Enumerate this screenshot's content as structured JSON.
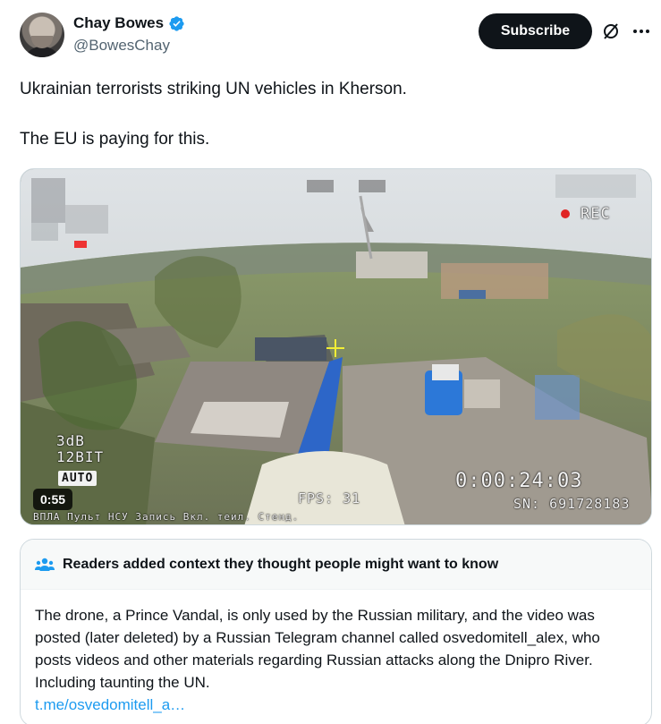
{
  "author": {
    "display_name": "Chay Bowes",
    "handle": "@BowesChay",
    "verified": true,
    "avatar_icon": "avatar-photo"
  },
  "actions": {
    "subscribe_label": "Subscribe",
    "grok_icon": "grok-slash-circle-icon",
    "more_icon": "more-horizontal-icon"
  },
  "tweet": {
    "lines": [
      "Ukrainian terrorists striking UN vehicles in Kherson.",
      "The EU is paying for this."
    ]
  },
  "media": {
    "duration": "0:55",
    "osd": {
      "gain": "3dB",
      "bits": "12BIT",
      "mode": "AUTO",
      "timer": "0:00:24:03",
      "serial": "SN: 691728183",
      "fps": "FPS: 31",
      "rec": "REC",
      "bottom_strip": "ВПЛА Пульт НСУ Запись Вкл. теил. Стенд."
    }
  },
  "community_note": {
    "title": "Readers added context they thought people might want to know",
    "body": "The drone, a Prince Vandal, is only used by the Russian military, and the video was posted (later deleted) by a Russian Telegram channel called osvedomitell_alex, who posts videos and other materials regarding Russian attacks along the Dnipro River. Including taunting the UN.",
    "link": "t.me/osvedomitell_a…"
  },
  "colors": {
    "accent_link": "#1d9bf0",
    "verified_badge": "#1d9bf0",
    "subscribe_bg": "#0f1419",
    "secondary_text": "#536471"
  }
}
